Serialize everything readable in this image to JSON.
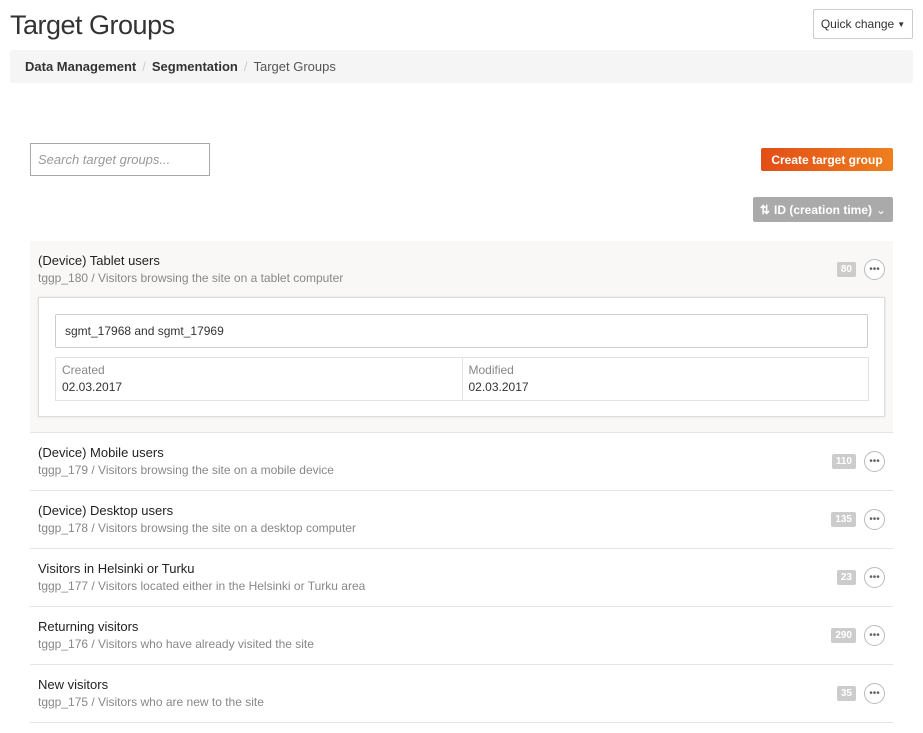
{
  "header": {
    "title": "Target Groups",
    "quick_change": "Quick change"
  },
  "breadcrumb": [
    "Data Management",
    "Segmentation",
    "Target Groups"
  ],
  "search": {
    "placeholder": "Search target groups...",
    "value": ""
  },
  "create_button": "Create target group",
  "sort_button": "ID (creation time)",
  "expanded": {
    "condition": "sgmt_17968  and sgmt_17969",
    "created_label": "Created",
    "created": "02.03.2017",
    "modified_label": "Modified",
    "modified": "02.03.2017"
  },
  "groups": [
    {
      "name": "(Device) Tablet users",
      "sub": "tggp_180 / Visitors browsing the site on a tablet computer",
      "count": "80"
    },
    {
      "name": "(Device) Mobile users",
      "sub": "tggp_179 / Visitors browsing the site on a mobile device",
      "count": "110"
    },
    {
      "name": "(Device) Desktop users",
      "sub": "tggp_178 / Visitors browsing the site on a desktop computer",
      "count": "135"
    },
    {
      "name": "Visitors in Helsinki or Turku",
      "sub": "tggp_177 / Visitors located either in the Helsinki or Turku area",
      "count": "23"
    },
    {
      "name": "Returning visitors",
      "sub": "tggp_176 / Visitors who have already visited the site",
      "count": "290"
    },
    {
      "name": "New visitors",
      "sub": "tggp_175 / Visitors who are new to the site",
      "count": "35"
    }
  ]
}
